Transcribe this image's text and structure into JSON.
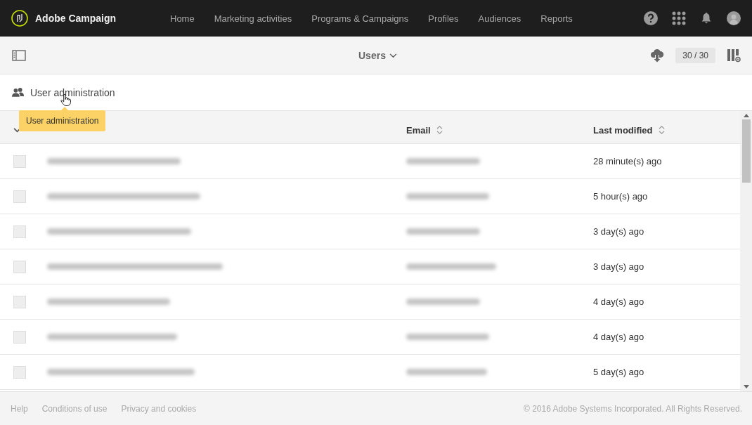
{
  "app": {
    "name": "Adobe Campaign"
  },
  "nav": [
    {
      "label": "Home",
      "selected": false
    },
    {
      "label": "Marketing activities",
      "selected": false
    },
    {
      "label": "Programs & Campaigns",
      "selected": false
    },
    {
      "label": "Profiles",
      "selected": false
    },
    {
      "label": "Audiences",
      "selected": false
    },
    {
      "label": "Reports",
      "selected": false
    }
  ],
  "toolbar": {
    "title": "Users",
    "count": "30 / 30"
  },
  "breadcrumb": {
    "label": "User administration"
  },
  "tooltip": {
    "text": "User administration"
  },
  "table": {
    "columns": [
      {
        "label": "Email",
        "sortable": true
      },
      {
        "label": "Last modified",
        "sortable": true
      }
    ],
    "rows": [
      {
        "selected": false,
        "modified": "28 minute(s) ago"
      },
      {
        "selected": false,
        "modified": "5 hour(s) ago"
      },
      {
        "selected": false,
        "modified": "3 day(s) ago"
      },
      {
        "selected": false,
        "modified": "3 day(s) ago"
      },
      {
        "selected": false,
        "modified": "4 day(s) ago"
      },
      {
        "selected": false,
        "modified": "4 day(s) ago"
      },
      {
        "selected": false,
        "modified": "5 day(s) ago"
      }
    ]
  },
  "footer": {
    "links": [
      "Help",
      "Conditions of use",
      "Privacy and cookies"
    ],
    "copyright": "© 2016 Adobe Systems Incorporated. All Rights Reserved."
  }
}
